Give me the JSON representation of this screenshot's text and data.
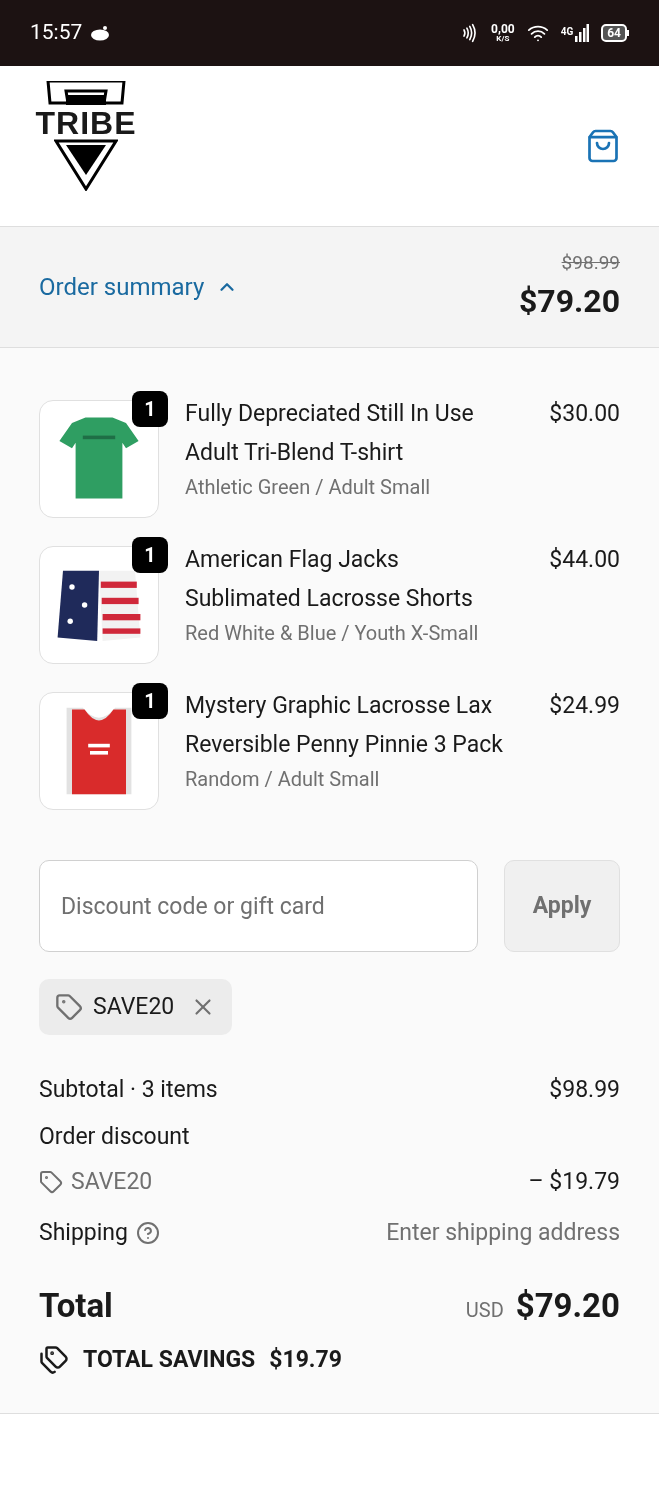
{
  "status_bar": {
    "time": "15:57",
    "net_speed": "0,00",
    "net_unit": "K/S",
    "network": "4G",
    "battery": "64"
  },
  "header": {
    "logo": "TRIBE"
  },
  "summary_bar": {
    "label": "Order summary",
    "expanded": true,
    "original_price": "$98.99",
    "price": "$79.20"
  },
  "items": [
    {
      "title": "Fully Depreciated Still In Use Adult Tri-Blend T-shirt",
      "variant": "Athletic Green / Adult Small",
      "price": "$30.00",
      "quantity": "1",
      "kind": "shirt"
    },
    {
      "title": "American Flag Jacks Sublimated Lacrosse Shorts",
      "variant": "Red White & Blue / Youth X-Small",
      "price": "$44.00",
      "quantity": "1",
      "kind": "shorts"
    },
    {
      "title": "Mystery Graphic Lacrosse Lax Reversible Penny Pinnie 3 Pack",
      "variant": "Random / Adult Small",
      "price": "$24.99",
      "quantity": "1",
      "kind": "pinnie"
    }
  ],
  "discount": {
    "placeholder": "Discount code or gift card",
    "button": "Apply",
    "applied_code": "SAVE20"
  },
  "totals": {
    "subtotal_label": "Subtotal · 3 items",
    "subtotal": "$98.99",
    "discount_label": "Order discount",
    "discount_code": "SAVE20",
    "discount_amount": "– $19.79",
    "shipping_label": "Shipping",
    "shipping_value": "Enter shipping address",
    "total_label": "Total",
    "currency": "USD",
    "total": "$79.20",
    "savings_label": "TOTAL SAVINGS",
    "savings": "$19.79"
  }
}
